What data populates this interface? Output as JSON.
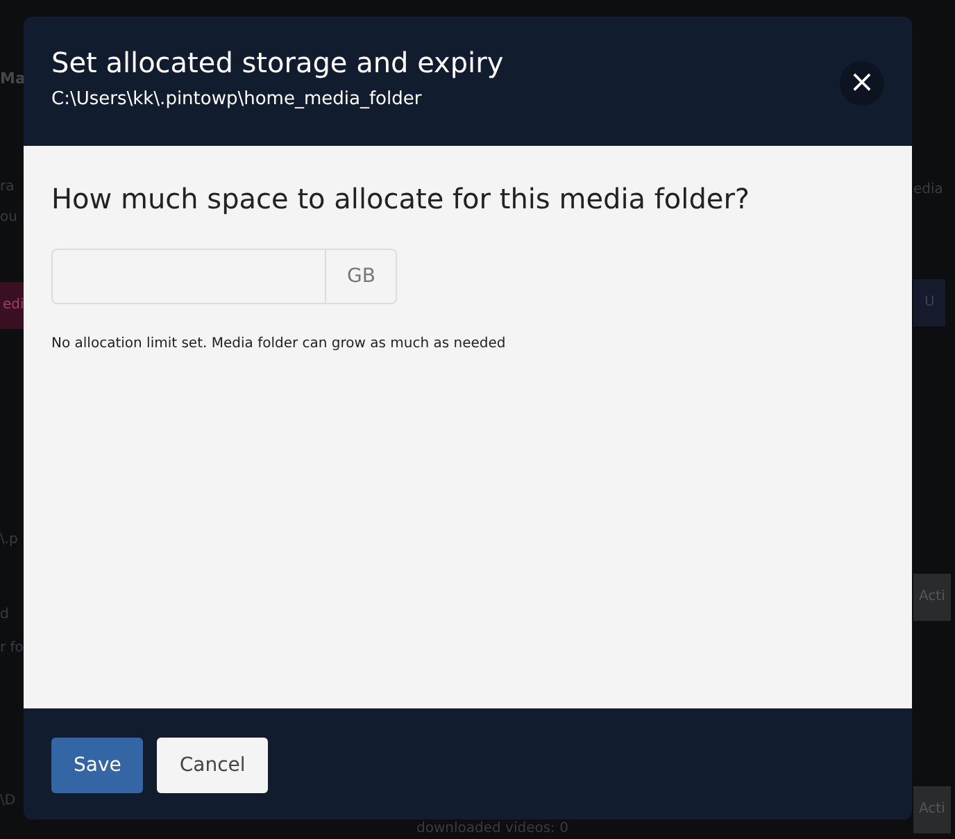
{
  "background": {
    "left": [
      {
        "kind": "heading",
        "text": "Ma"
      },
      {
        "kind": "text",
        "text": "ra"
      },
      {
        "kind": "text",
        "text": "ou"
      },
      {
        "kind": "pink-button",
        "text": "edi"
      },
      {
        "kind": "text",
        "text": "\\.p"
      },
      {
        "kind": "text",
        "text": "d"
      },
      {
        "kind": "text",
        "text": "r fo"
      },
      {
        "kind": "text",
        "text": "\\D"
      }
    ],
    "right": [
      {
        "kind": "text",
        "text": "edia"
      },
      {
        "kind": "blue-button",
        "text": "U"
      },
      {
        "kind": "grey-button",
        "text": "Acti"
      },
      {
        "kind": "grey-button",
        "text": "Acti"
      }
    ],
    "bottom": "downloaded videos: 0"
  },
  "dialog": {
    "title": "Set allocated storage and expiry",
    "subtitle": "C:\\Users\\kk\\.pintowp\\home_media_folder",
    "close": "×",
    "question": "How much space to allocate for this media folder?",
    "field": {
      "unit": "GB"
    },
    "hint": "No allocation limit set. Media folder can grow as much as needed",
    "buttons": [
      {
        "kind": "primary",
        "label": "Save"
      },
      {
        "kind": "secondary",
        "label": "Cancel"
      }
    ]
  }
}
